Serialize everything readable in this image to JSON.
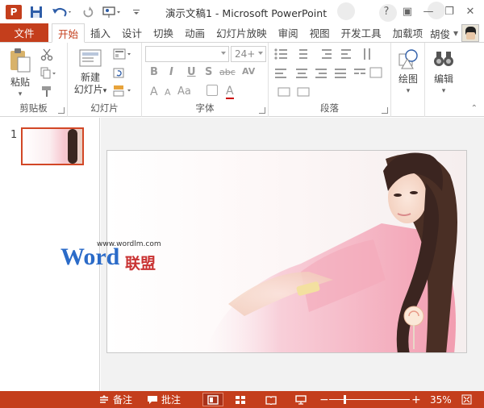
{
  "window": {
    "title": "演示文稿1 - Microsoft PowerPoint",
    "app_icon_letter": "P",
    "controls": [
      "?",
      "▣",
      "—",
      "❐",
      "✕"
    ]
  },
  "tabs": {
    "file": "文件",
    "items": [
      "开始",
      "插入",
      "设计",
      "切换",
      "动画",
      "幻灯片放映",
      "审阅",
      "视图",
      "开发工具",
      "加载项"
    ],
    "active": "开始",
    "user_name": "胡俊",
    "user_dropdown": "▾"
  },
  "ribbon": {
    "clipboard": {
      "label": "剪贴板",
      "paste": "粘贴",
      "paste_arrow": "▾"
    },
    "slides": {
      "label": "幻灯片",
      "new_line1": "新建",
      "new_line2": "幻灯片",
      "new_arrow": "▾"
    },
    "font": {
      "label": "字体",
      "font_name": "",
      "font_size": "24+",
      "bold": "B",
      "italic": "I",
      "underline": "U",
      "shadow": "S",
      "strike": "abc",
      "spacing": "AV",
      "size_up": "A",
      "size_down": "A",
      "case": "Aa",
      "color": "A"
    },
    "paragraph": {
      "label": "段落"
    },
    "drawing": {
      "label": "绘图"
    },
    "editing": {
      "label": "编辑"
    }
  },
  "thumbnails": [
    {
      "number": "1"
    }
  ],
  "watermark": {
    "url": "www.wordlm.com",
    "word": "Word",
    "cn": "联盟"
  },
  "status": {
    "notes": "备注",
    "comments": "批注",
    "zoom_minus": "−",
    "zoom_plus": "+",
    "zoom_percent": "35%",
    "zoom_level": 0.35
  },
  "colors": {
    "accent": "#c43e1c",
    "thumb_border": "#d24726",
    "wm_blue": "#2b6bc8",
    "wm_red": "#c93232"
  }
}
